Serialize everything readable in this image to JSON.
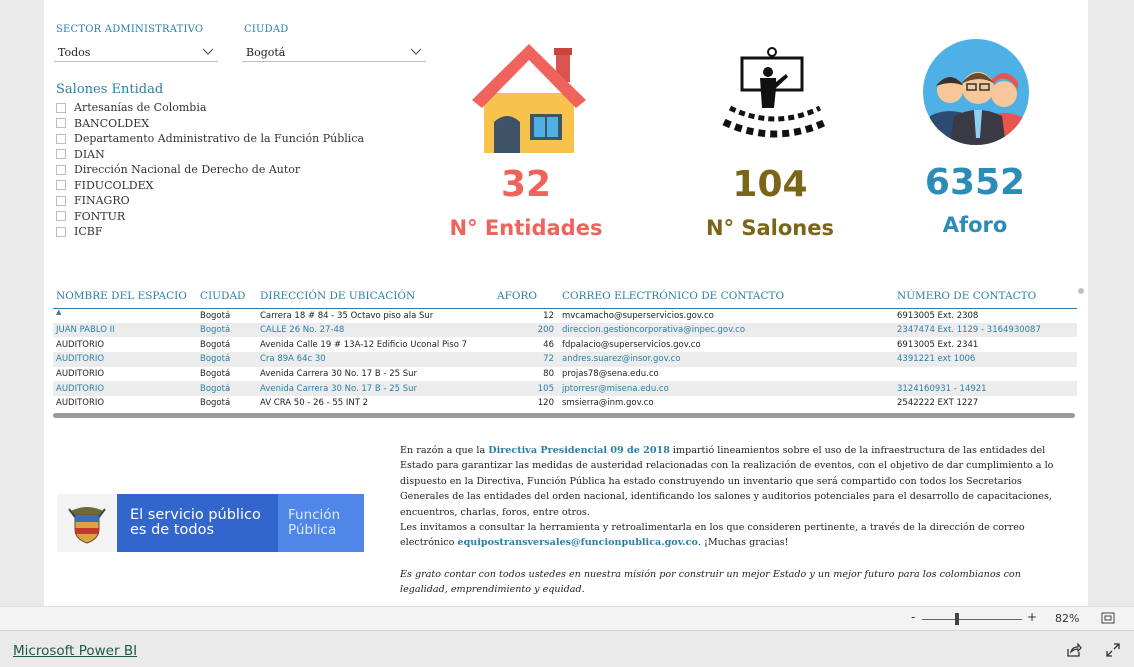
{
  "filters": {
    "sector_label": "SECTOR ADMINISTRATIVO",
    "sector_value": "Todos",
    "ciudad_label": "CIUDAD",
    "ciudad_value": "Bogotá"
  },
  "slicer": {
    "title": "Salones Entidad",
    "items": [
      "Artesanías de Colombia",
      "BANCOLDEX",
      "Departamento Administrativo de la Función Pública",
      "DIAN",
      "Dirección Nacional de Derecho de Autor",
      "FIDUCOLDEX",
      "FINAGRO",
      "FONTUR",
      "ICBF"
    ]
  },
  "kpis": {
    "entidades_value": "32",
    "entidades_label": "N° Entidades",
    "entidades_color": "#f0625c",
    "salones_value": "104",
    "salones_label": "N° Salones",
    "salones_color": "#7a6519",
    "aforo_value": "6352",
    "aforo_label": "Aforo",
    "aforo_color": "#2b8cb8"
  },
  "table": {
    "headers": [
      "NOMBRE DEL ESPACIO",
      "CIUDAD",
      "DIRECCIÓN DE UBICACIÓN",
      "AFORO",
      "CORREO ELECTRÓNICO DE CONTACTO",
      "NÚMERO DE CONTACTO"
    ],
    "rows": [
      [
        "",
        "Bogotá",
        "Carrera 18 # 84 - 35 Octavo piso ala Sur",
        "12",
        "mvcamacho@superservicios.gov.co",
        "6913005 Ext. 2308"
      ],
      [
        "JUAN PABLO II",
        "Bogotá",
        "CALLE 26 No. 27-48",
        "200",
        "direccion.gestioncorporativa@inpec.gov.co",
        "2347474 Ext. 1129 - 3164930087"
      ],
      [
        "AUDITORIO",
        "Bogotá",
        "Avenida Calle 19 # 13A-12 Edificio Uconal Piso 7",
        "46",
        "fdpalacio@superservicios.gov.co",
        "6913005 Ext. 2341"
      ],
      [
        "AUDITORIO",
        "Bogotá",
        "Cra 89A 64c 30",
        "72",
        "andres.suarez@insor.gov.co",
        "4391221 ext 1006"
      ],
      [
        "AUDITORIO",
        "Bogotá",
        "Avenida Carrera 30 No. 17 B - 25 Sur",
        "80",
        "projas78@sena.edu.co",
        ""
      ],
      [
        "AUDITORIO",
        "Bogotá",
        "Avenida Carrera 30 No. 17 B - 25 Sur",
        "105",
        "jptorresr@misena.edu.co",
        "3124160931 - 14921"
      ],
      [
        "AUDITORIO",
        "Bogotá",
        "AV CRA 50 - 26 - 55 INT 2",
        "120",
        "smsierra@inm.gov.co",
        "2542222 EXT 1227"
      ]
    ]
  },
  "logo": {
    "line1": "El servicio público",
    "line2": "es de todos",
    "right1": "Función",
    "right2": "Pública"
  },
  "info": {
    "p1_a": "En razón a que la ",
    "p1_bold": "Directiva Presidencial 09 de 2018",
    "p1_b": " impartió lineamientos sobre el uso de la infraestructura de las entidades del Estado para garantizar las medidas de austeridad relacionadas con la realización de eventos, con el objetivo de dar cumplimiento a lo dispuesto en la Directiva, Función Pública ha estado construyendo un inventario que será compartido con todos los Secretarios Generales de las entidades del orden nacional, identificando los salones y auditorios potenciales para el desarrollo de capacitaciones, encuentros, charlas, foros, entre otros.",
    "p2_a": "Les invitamos a consultar la herramienta y retroalimentarla en los que consideren pertinente, a través de la dirección de correo electrónico ",
    "p2_email": "equipostransversales@funcionpublica.gov.co",
    "p2_b": ". ¡Muchas gracias!",
    "p3": "Es grato contar con todos ustedes en nuestra misión por construir un mejor Estado y un mejor futuro para los colombianos con legalidad, emprendimiento y equidad."
  },
  "footer": {
    "brand": "Microsoft Power BI",
    "zoom_minus": "-",
    "zoom_plus": "+",
    "zoom_level": "82%",
    "zoom_fraction": 0.35
  }
}
